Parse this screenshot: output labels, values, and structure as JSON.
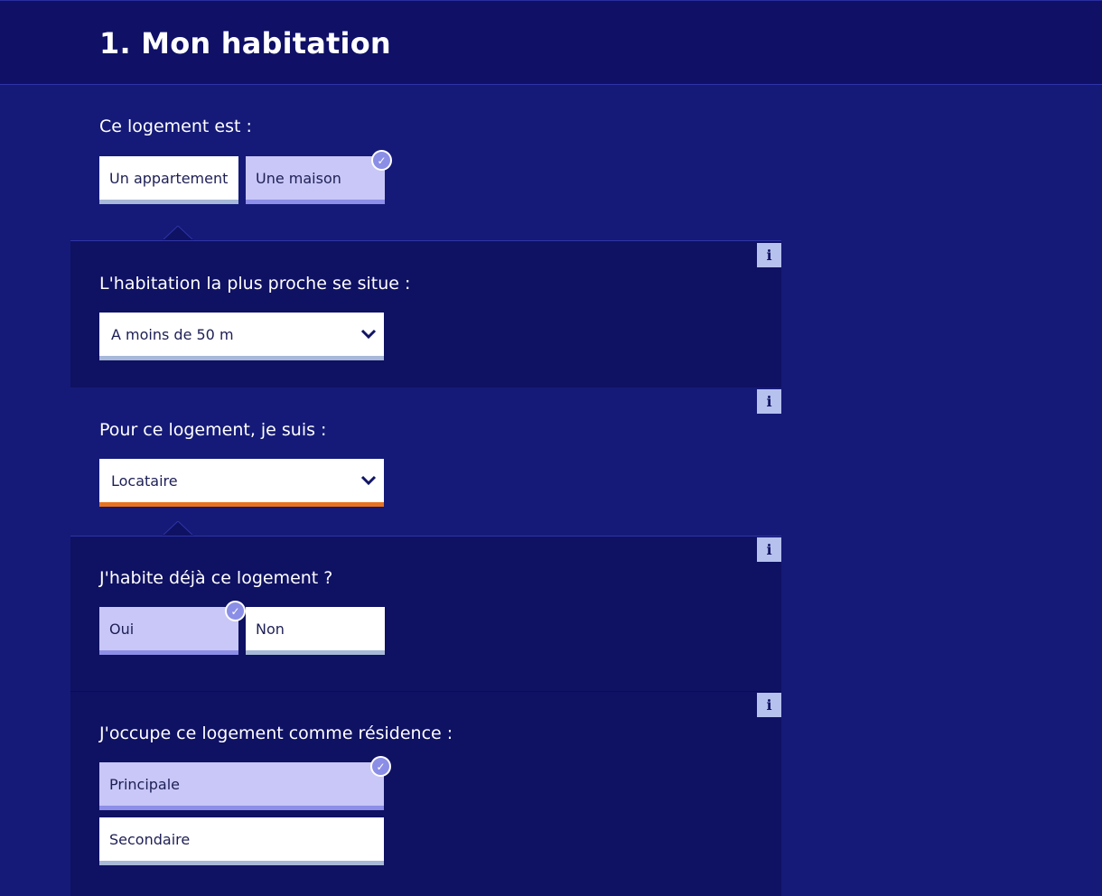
{
  "header": {
    "title": "1. Mon habitation"
  },
  "q1": {
    "label": "Ce logement est :",
    "options": [
      "Un appartement",
      "Une maison"
    ],
    "selected": "Une maison"
  },
  "q2": {
    "label": "L'habitation la plus proche se situe :",
    "value": "A moins de 50 m",
    "info": "i"
  },
  "q3": {
    "label": "Pour ce logement, je suis :",
    "value": "Locataire",
    "info": "i"
  },
  "q4": {
    "label": "J'habite déjà ce logement ?",
    "options": [
      "Oui",
      "Non"
    ],
    "selected": "Oui",
    "info": "i"
  },
  "q5": {
    "label": "J'occupe ce logement comme résidence :",
    "options": [
      "Principale",
      "Secondaire"
    ],
    "selected": "Principale",
    "info": "i"
  },
  "colors": {
    "background": "#151a78",
    "header_bg": "#0f1066",
    "section_dark": "#0f1163",
    "selected_option": "#c9c7f7",
    "active_underline": "#e8731f",
    "info_bg": "#b6c1ee"
  },
  "icons": {
    "check": "check-circle-icon",
    "chevron": "chevron-down-icon",
    "info": "info-icon"
  }
}
